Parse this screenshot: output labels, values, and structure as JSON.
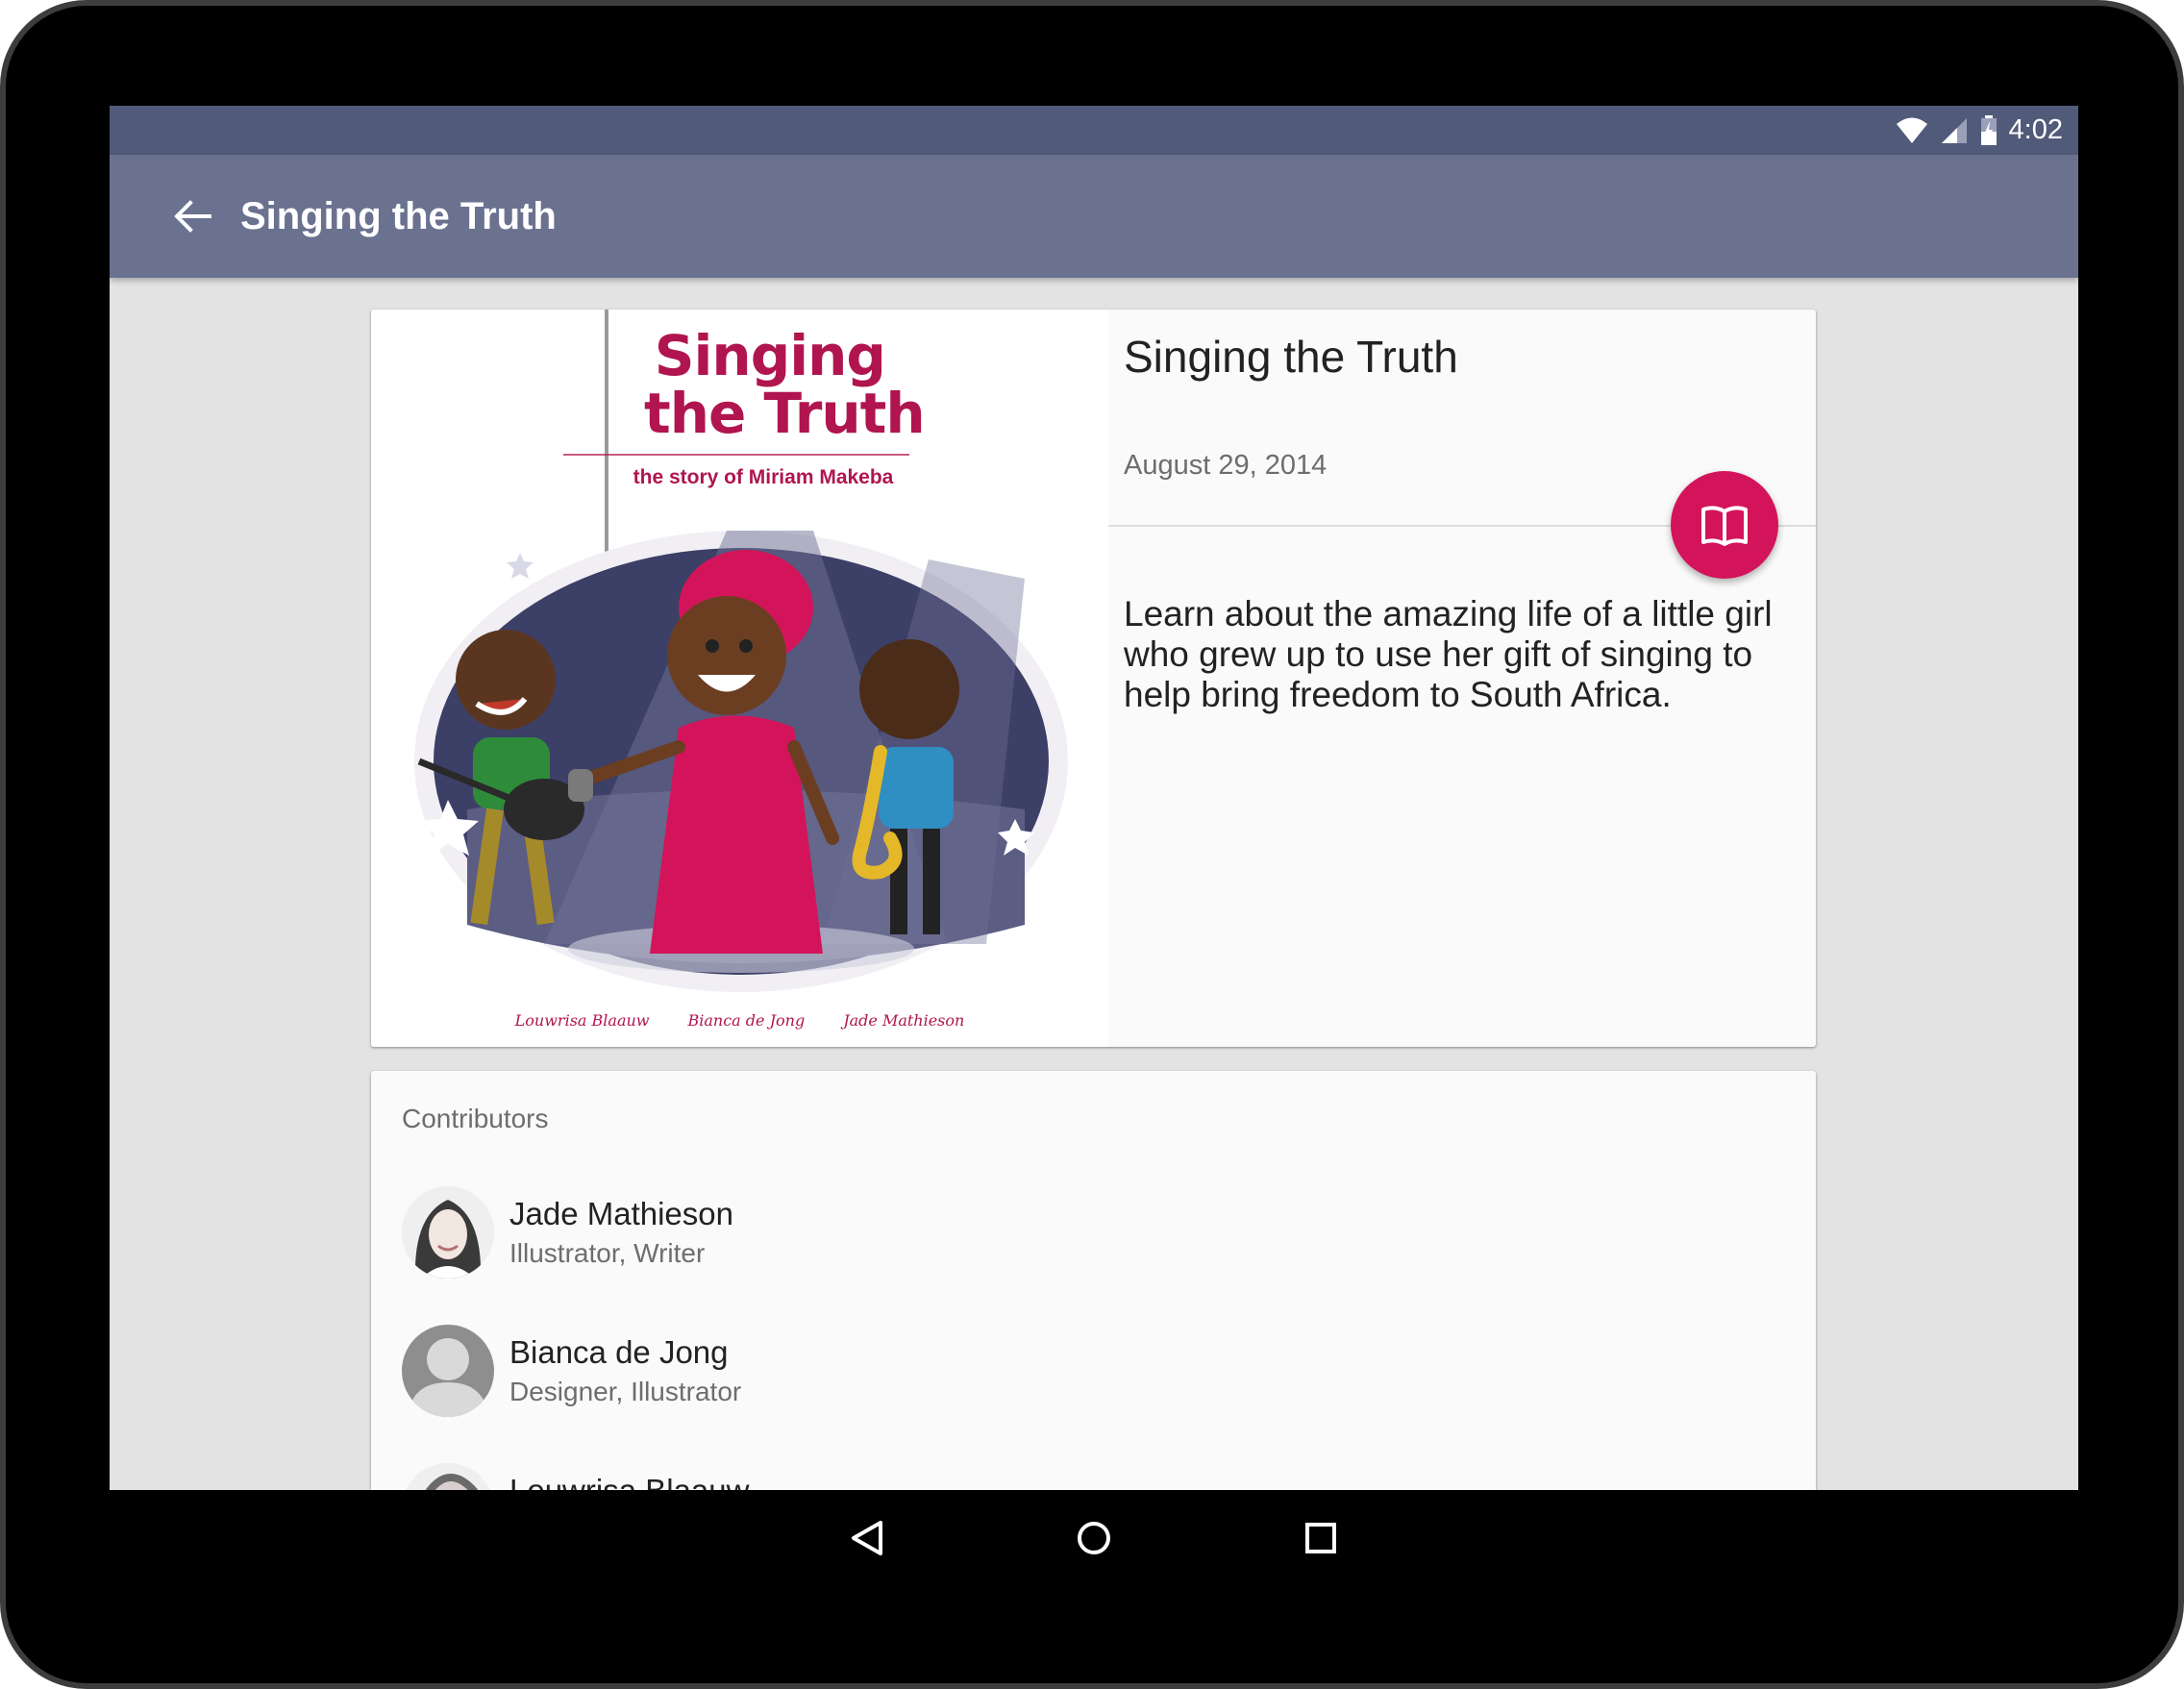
{
  "status_bar": {
    "time": "4:02",
    "icons": [
      "wifi-icon",
      "cellular-icon",
      "battery-charging-icon"
    ]
  },
  "app_bar": {
    "back_icon": "arrow-back-icon",
    "title": "Singing the Truth"
  },
  "book": {
    "cover": {
      "title_line1": "Singing",
      "title_line2": "the Truth",
      "subtitle": "the story of Miriam Makeba",
      "credits": [
        "Louwrisa Blaauw",
        "Bianca de Jong",
        "Jade Mathieson"
      ]
    },
    "title": "Singing the Truth",
    "date": "August 29, 2014",
    "description": "Learn about the amazing life of a little girl who grew up to use her gift of singing to help bring freedom to South Africa.",
    "read_button_icon": "open-book-icon",
    "accent_color": "#d4145a"
  },
  "contributors": {
    "heading": "Contributors",
    "items": [
      {
        "name": "Jade Mathieson",
        "role": "Illustrator, Writer"
      },
      {
        "name": "Bianca de Jong",
        "role": "Designer, Illustrator"
      },
      {
        "name": "Louwrisa Blaauw",
        "role": ""
      }
    ]
  },
  "nav_bar": {
    "icons": [
      "back-triangle-icon",
      "home-circle-icon",
      "recents-square-icon"
    ]
  },
  "colors": {
    "status_bar": "#525a7a",
    "app_bar": "#6a7290",
    "background": "#e3e3e3"
  }
}
